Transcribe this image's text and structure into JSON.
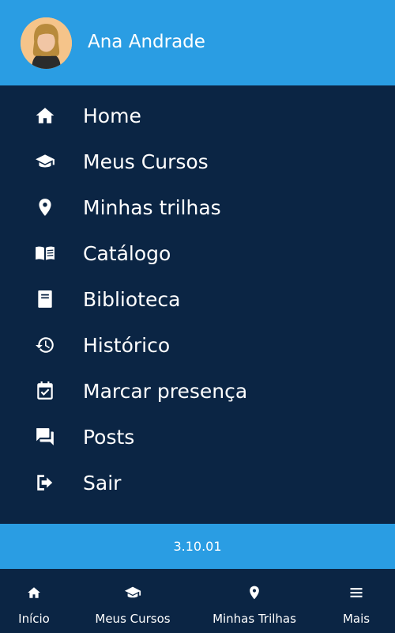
{
  "header": {
    "user_name": "Ana Andrade",
    "avatar_icon": "user-avatar-woman"
  },
  "colors": {
    "header_bg": "#2a9de3",
    "menu_bg": "#0b2544",
    "text": "#ffffff"
  },
  "menu": {
    "items": [
      {
        "label": "Home",
        "icon": "home-icon"
      },
      {
        "label": "Meus Cursos",
        "icon": "graduation-cap-icon"
      },
      {
        "label": "Minhas trilhas",
        "icon": "map-pin-icon"
      },
      {
        "label": "Catálogo",
        "icon": "open-book-icon"
      },
      {
        "label": "Biblioteca",
        "icon": "book-icon"
      },
      {
        "label": "Histórico",
        "icon": "history-icon"
      },
      {
        "label": "Marcar presença",
        "icon": "calendar-check-icon"
      },
      {
        "label": "Posts",
        "icon": "chat-icon"
      },
      {
        "label": "Sair",
        "icon": "logout-icon"
      }
    ]
  },
  "version": "3.10.01",
  "bottom_nav": {
    "items": [
      {
        "label": "Início",
        "icon": "home-icon"
      },
      {
        "label": "Meus Cursos",
        "icon": "graduation-cap-icon"
      },
      {
        "label": "Minhas Trilhas",
        "icon": "map-pin-icon"
      },
      {
        "label": "Mais",
        "icon": "menu-icon"
      }
    ]
  }
}
